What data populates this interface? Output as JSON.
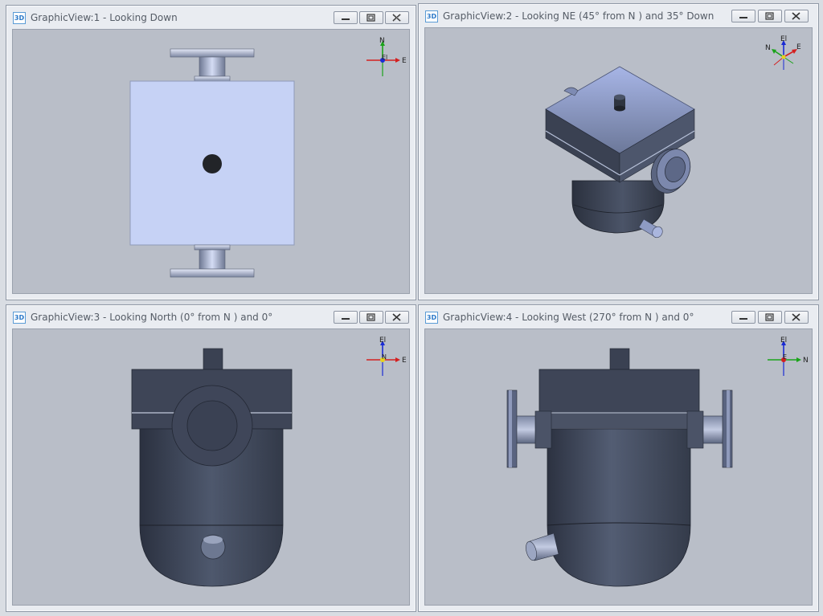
{
  "views": [
    {
      "title": "GraphicView:1 - Looking Down",
      "icon_label": "3D",
      "triad": {
        "top": "N",
        "right": "E",
        "center": "El"
      }
    },
    {
      "title": "GraphicView:2 - Looking NE (45° from N ) and 35° Down",
      "icon_label": "3D",
      "triad": {
        "top": "El",
        "right": "E",
        "left": "N"
      }
    },
    {
      "title": "GraphicView:3 - Looking North (0° from N ) and 0°",
      "icon_label": "3D",
      "triad": {
        "top": "El",
        "right": "E",
        "center": "N"
      }
    },
    {
      "title": "GraphicView:4 - Looking West (270° from N ) and 0°",
      "icon_label": "3D",
      "triad": {
        "top": "El",
        "right": "N",
        "center": "E"
      }
    }
  ],
  "window_buttons": [
    "minimize-icon",
    "maximize-icon",
    "close-icon"
  ],
  "colors": {
    "viewport_bg": "#b9bec8",
    "model_top": "#c6d2f5",
    "model_dark": "#3c4454",
    "north_axis": "#1aa31a",
    "east_axis": "#d42020",
    "up_axis": "#1a2bd4"
  }
}
